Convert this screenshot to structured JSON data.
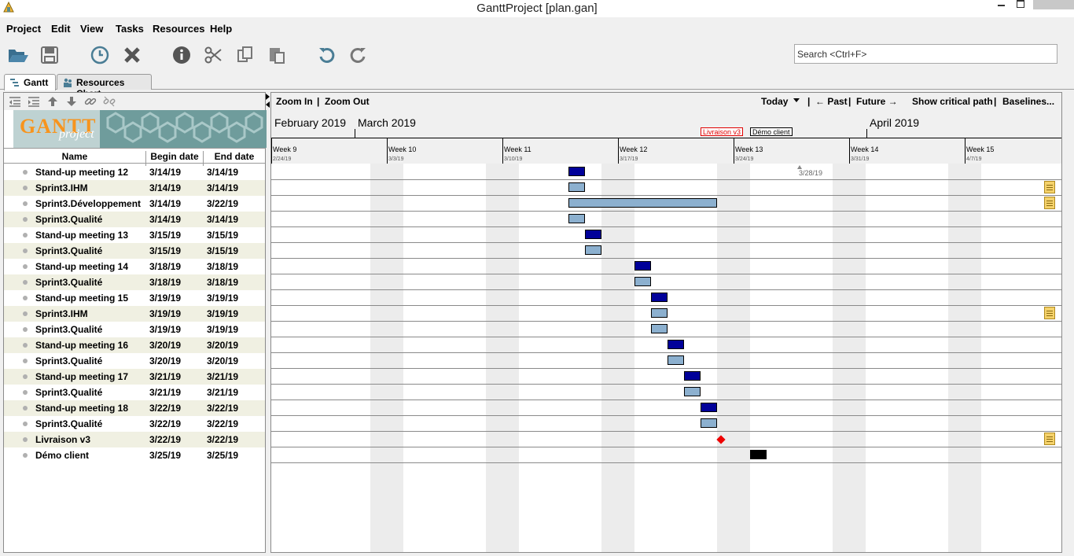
{
  "window": {
    "title": "GanttProject [plan.gan]"
  },
  "menu": [
    "Project",
    "Edit",
    "View",
    "Tasks",
    "Resources",
    "Help"
  ],
  "search": {
    "placeholder": "Search <Ctrl+F>"
  },
  "tabs": [
    {
      "label": "Gantt",
      "icon": "gantt-icon"
    },
    {
      "label": "Resources Chart",
      "icon": "resources-icon"
    }
  ],
  "table": {
    "columns": [
      "Name",
      "Begin date",
      "End date"
    ],
    "rows": [
      {
        "name": "Stand-up meeting 12",
        "begin": "3/14/19",
        "end": "3/14/19"
      },
      {
        "name": "Sprint3.IHM",
        "begin": "3/14/19",
        "end": "3/14/19"
      },
      {
        "name": "Sprint3.Développement",
        "begin": "3/14/19",
        "end": "3/22/19"
      },
      {
        "name": "Sprint3.Qualité",
        "begin": "3/14/19",
        "end": "3/14/19"
      },
      {
        "name": "Stand-up meeting 13",
        "begin": "3/15/19",
        "end": "3/15/19"
      },
      {
        "name": "Sprint3.Qualité",
        "begin": "3/15/19",
        "end": "3/15/19"
      },
      {
        "name": "Stand-up meeting 14",
        "begin": "3/18/19",
        "end": "3/18/19"
      },
      {
        "name": "Sprint3.Qualité",
        "begin": "3/18/19",
        "end": "3/18/19"
      },
      {
        "name": "Stand-up meeting 15",
        "begin": "3/19/19",
        "end": "3/19/19"
      },
      {
        "name": "Sprint3.IHM",
        "begin": "3/19/19",
        "end": "3/19/19"
      },
      {
        "name": "Sprint3.Qualité",
        "begin": "3/19/19",
        "end": "3/19/19"
      },
      {
        "name": "Stand-up meeting 16",
        "begin": "3/20/19",
        "end": "3/20/19"
      },
      {
        "name": "Sprint3.Qualité",
        "begin": "3/20/19",
        "end": "3/20/19"
      },
      {
        "name": "Stand-up meeting 17",
        "begin": "3/21/19",
        "end": "3/21/19"
      },
      {
        "name": "Sprint3.Qualité",
        "begin": "3/21/19",
        "end": "3/21/19"
      },
      {
        "name": "Stand-up meeting 18",
        "begin": "3/22/19",
        "end": "3/22/19"
      },
      {
        "name": "Sprint3.Qualité",
        "begin": "3/22/19",
        "end": "3/22/19"
      },
      {
        "name": "Livraison v3",
        "begin": "3/22/19",
        "end": "3/22/19"
      },
      {
        "name": "Démo client",
        "begin": "3/25/19",
        "end": "3/25/19"
      }
    ]
  },
  "chart": {
    "toolbar": {
      "zoom_in": "Zoom In",
      "sep1": "|",
      "zoom_out": "Zoom Out",
      "today": "Today",
      "sep2": "|",
      "past": "← Past",
      "sep3": "|",
      "future": "Future →",
      "critical": "Show critical path",
      "sep4": "|",
      "baselines": "Baselines..."
    },
    "months": [
      "February 2019",
      "March 2019",
      "April 2019"
    ],
    "weeks": [
      {
        "label": "Week 9",
        "date": "2/24/19"
      },
      {
        "label": "Week 10",
        "date": "3/3/19"
      },
      {
        "label": "Week 11",
        "date": "3/10/19"
      },
      {
        "label": "Week 12",
        "date": "3/17/19"
      },
      {
        "label": "Week 13",
        "date": "3/24/19"
      },
      {
        "label": "Week 14",
        "date": "3/31/19"
      },
      {
        "label": "Week 15",
        "date": "4/7/19"
      }
    ],
    "milestone_flags": [
      "Livraison v3",
      "Démo client"
    ],
    "today_marker": "3/28/19",
    "colors": {
      "meeting": "#000099",
      "task": "#8cb0cf",
      "milestone": "#ee0000",
      "demo": "#000000"
    }
  }
}
